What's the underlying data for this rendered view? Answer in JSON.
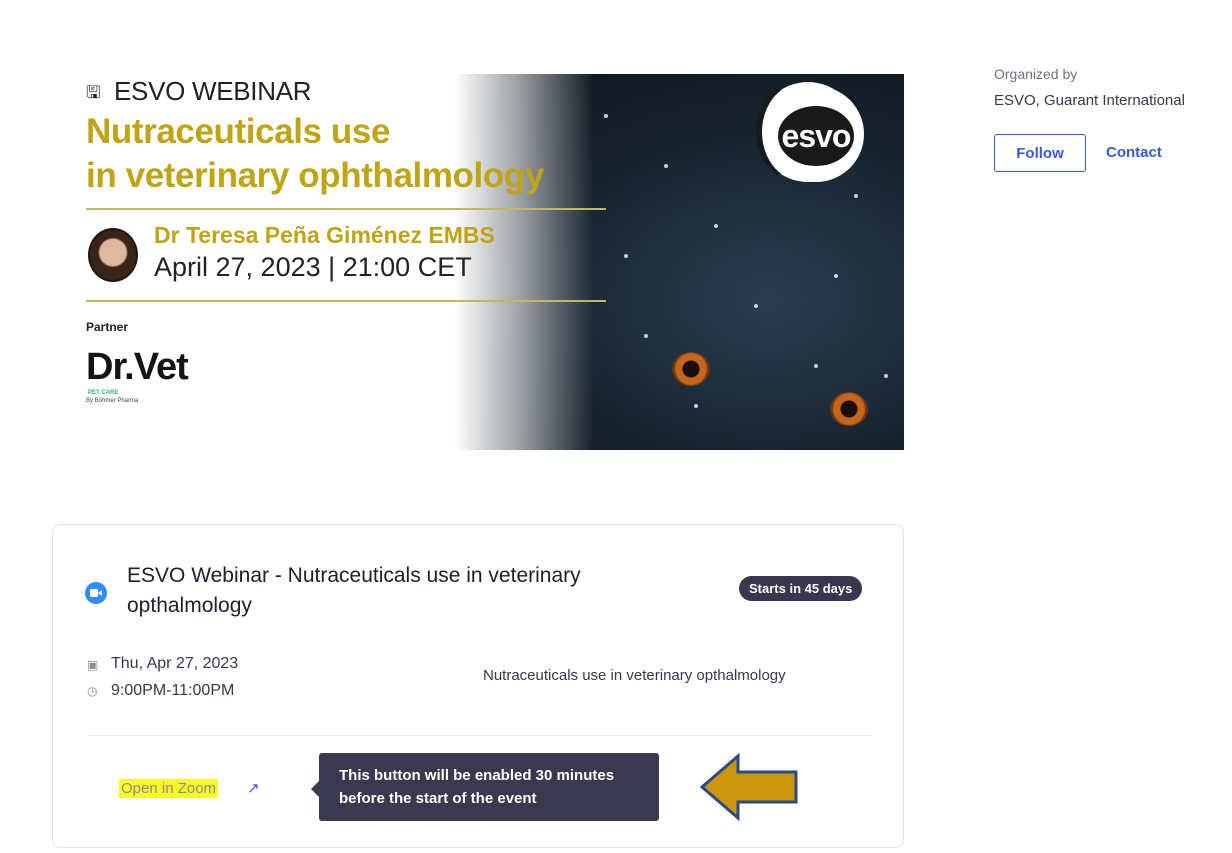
{
  "banner": {
    "webinar_label": "ESVO WEBINAR",
    "headline_line1": "Nutraceuticals use",
    "headline_line2": "in veterinary ophthalmology",
    "speaker": "Dr Teresa Peña Giménez EMBS",
    "date_time": "April 27, 2023 | 21:00 CET",
    "partner_label": "Partner",
    "partner_logo_text": "Dr.Vet",
    "partner_logo_sub": "PET CARE",
    "partner_logo_by": "By Böhmer Pharma",
    "esvo_logo_text": "esvo",
    "headline_color": "#c1a414"
  },
  "organizer": {
    "label": "Organized by",
    "name": "ESVO, Guarant International",
    "follow_label": "Follow",
    "contact_label": "Contact",
    "accent_color": "#3659e3"
  },
  "event": {
    "icon": "zoom-video-icon",
    "title": "ESVO Webinar - Nutraceuticals use in veterinary opthalmology",
    "badge": "Starts in 45 days",
    "date": "Thu, Apr 27, 2023",
    "time": "9:00PM-11:00PM",
    "description": "Nutraceuticals use in veterinary opthalmology",
    "open_label": "Open in Zoom",
    "tooltip": "This button will be enabled 30 minutes before the start of the event"
  },
  "annotation": {
    "arrow_color": "#c9960c",
    "arrow_outline": "#2b4a8a"
  }
}
